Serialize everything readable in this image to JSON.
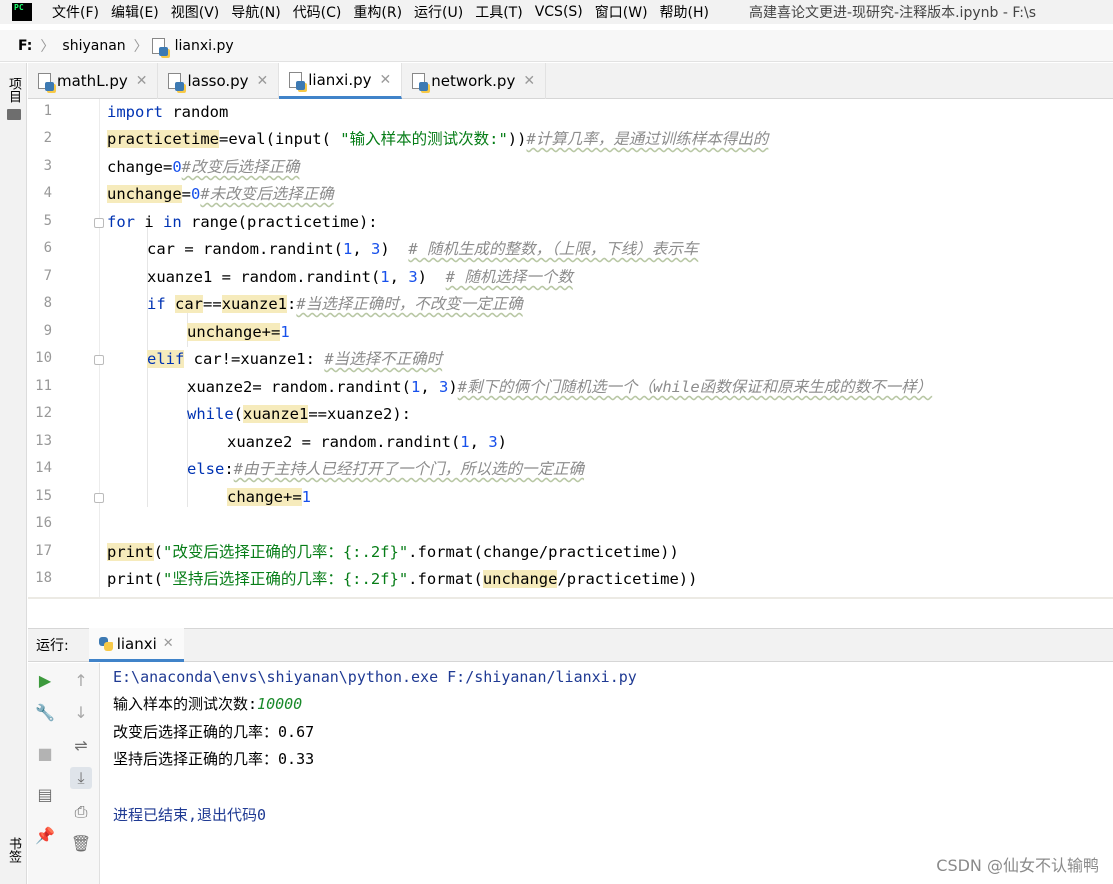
{
  "menubar": {
    "logo": "PC",
    "items": [
      "文件(F)",
      "编辑(E)",
      "视图(V)",
      "导航(N)",
      "代码(C)",
      "重构(R)",
      "运行(U)",
      "工具(T)",
      "VCS(S)",
      "窗口(W)",
      "帮助(H)"
    ],
    "window_title": "高建喜论文更进-现研究-注释版本.ipynb - F:\\s"
  },
  "breadcrumb": {
    "drive": "F:",
    "folder": "shiyanan",
    "file": "lianxi.py"
  },
  "left_strip": {
    "top_label": "项目",
    "bottom_label": "书签"
  },
  "tabs": [
    {
      "label": "mathL.py",
      "active": false
    },
    {
      "label": "lasso.py",
      "active": false
    },
    {
      "label": "lianxi.py",
      "active": true
    },
    {
      "label": "network.py",
      "active": false
    }
  ],
  "editor": {
    "line_numbers": [
      "1",
      "2",
      "3",
      "4",
      "5",
      "6",
      "7",
      "8",
      "9",
      "10",
      "11",
      "12",
      "13",
      "14",
      "15",
      "16",
      "17",
      "18"
    ],
    "code": {
      "l1_kw": "import",
      "l1_rest": " random",
      "l2_var": "practicetime",
      "l2_a": "=eval(input(",
      "l2_str": " \"输入样本的测试次数:\"",
      "l2_b": "))",
      "l2_cmt": "#计算几率，是通过训练样本得出的",
      "l3_a": "change=",
      "l3_num": "0",
      "l3_cmt": "#改变后选择正确",
      "l4_var": "unchange",
      "l4_a": "=",
      "l4_num": "0",
      "l4_cmt": "#未改变后选择正确",
      "l5_kw1": "for",
      "l5_a": " i ",
      "l5_kw2": "in",
      "l5_b": " range(practicetime):",
      "l6_a": "car = random.randint(",
      "l6_n1": "1",
      "l6_b": ", ",
      "l6_n2": "3",
      "l6_c": ")  ",
      "l6_cmt": "# 随机生成的整数，（上限，下线）表示车",
      "l7_a": "xuanze1 = random.randint(",
      "l7_n1": "1",
      "l7_b": ", ",
      "l7_n2": "3",
      "l7_c": ")  ",
      "l7_cmt": "# 随机选择一个数",
      "l8_kw": "if",
      "l8_a": " ",
      "l8_v1": "car",
      "l8_b": "==",
      "l8_v2": "xuanze1",
      "l8_c": ":",
      "l8_cmt": "#当选择正确时，不改变一定正确",
      "l9_var": "unchange+=",
      "l9_num": "1",
      "l10_kw": "elif",
      "l10_a": " car!=xuanze1: ",
      "l10_cmt": "#当选择不正确时",
      "l11_a": "xuanze2= random.randint(",
      "l11_n1": "1",
      "l11_b": ", ",
      "l11_n2": "3",
      "l11_c": ")",
      "l11_cmt": "#剩下的俩个门随机选一个（while函数保证和原来生成的数不一样）",
      "l12_kw": "while",
      "l12_a": "(",
      "l12_var": "xuanze1",
      "l12_b": "==xuanze2):",
      "l13_a": "xuanze2 = random.randint(",
      "l13_n1": "1",
      "l13_b": ", ",
      "l13_n2": "3",
      "l13_c": ")",
      "l14_kw": "else",
      "l14_a": ":",
      "l14_cmt": "#由于主持人已经打开了一个门，所以选的一定正确",
      "l15_var": "change+=",
      "l15_num": "1",
      "l17_fn": "print",
      "l17_a": "(",
      "l17_str": "\"改变后选择正确的几率：{:.2f}\"",
      "l17_b": ".format(change/practicetime))",
      "l18_a": "print(",
      "l18_str": "\"坚持后选择正确的几率：{:.2f}\"",
      "l18_b": ".format(",
      "l18_var": "unchange",
      "l18_c": "/practicetime))"
    }
  },
  "run_panel": {
    "label": "运行:",
    "tab": "lianxi",
    "output": {
      "command": "E:\\anaconda\\envs\\shiyanan\\python.exe F:/shiyanan/lianxi.py",
      "prompt": "输入样本的测试次数:",
      "input_value": "10000",
      "line_change": "改变后选择正确的几率：0.67",
      "line_keep": "坚持后选择正确的几率：0.33",
      "exit": "进程已结束,退出代码0"
    }
  },
  "watermark": "CSDN @仙女不认输鸭",
  "icons": {
    "run": "play-icon",
    "wrench": "wrench-icon",
    "stop": "stop-icon",
    "layout": "layout-icon",
    "pin": "pin-icon",
    "up": "arrow-up-icon",
    "down": "arrow-down-icon",
    "wrap": "soft-wrap-icon",
    "scroll": "scroll-to-end-icon",
    "print": "print-icon",
    "trash": "trash-icon"
  },
  "colors": {
    "keyword": "#0033b3",
    "string": "#067d17",
    "number": "#1750eb",
    "comment": "#8c8c8c",
    "highlight": "#f6ebbc",
    "accent": "#4083c9"
  }
}
